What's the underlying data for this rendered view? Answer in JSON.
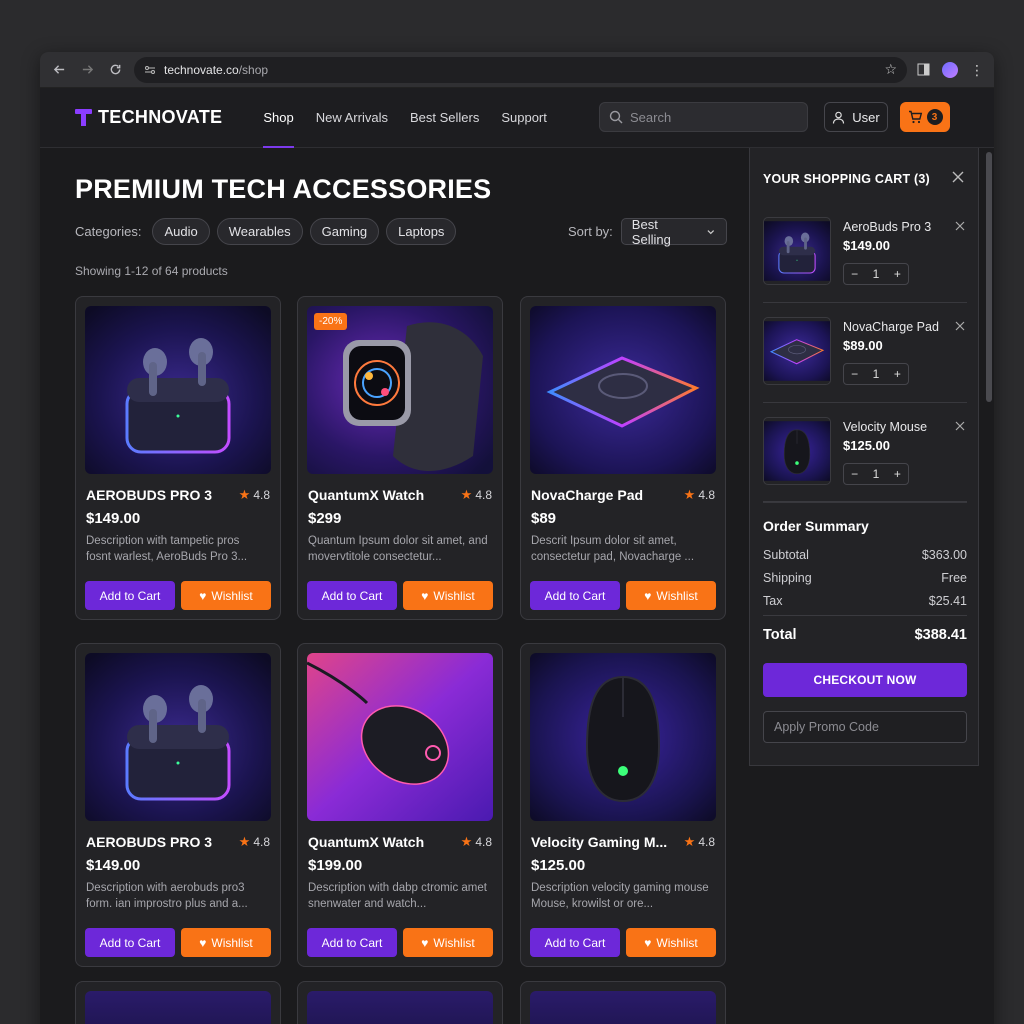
{
  "browser": {
    "url_domain": "technovate.co",
    "url_path": "/shop"
  },
  "header": {
    "logo_text": "TECHNOVATE",
    "nav": [
      {
        "label": "Shop",
        "active": true
      },
      {
        "label": "New Arrivals",
        "active": false
      },
      {
        "label": "Best Sellers",
        "active": false
      },
      {
        "label": "Support",
        "active": false
      }
    ],
    "search_placeholder": "Search",
    "user_label": "User",
    "cart_count": "3"
  },
  "main": {
    "title": "PREMIUM TECH ACCESSORIES",
    "categories_label": "Categories:",
    "categories": [
      "Audio",
      "Wearables",
      "Gaming",
      "Laptops"
    ],
    "sort_label": "Sort by:",
    "sort_value": "Best Selling",
    "showing_text": "Showing 1-12 of 64 products"
  },
  "products": [
    {
      "name": "AEROBUDS PRO 3",
      "rating": "4.8",
      "price": "$149.00",
      "description": "Description with tampetic pros fosnt warlest, AeroBuds Pro 3...",
      "image": "earbuds",
      "discount": ""
    },
    {
      "name": "QuantumX Watch",
      "rating": "4.8",
      "price": "$299",
      "description": "Quantum Ipsum dolor sit amet, and movervtitole consectetur...",
      "image": "watch",
      "discount": "-20%"
    },
    {
      "name": "NovaCharge Pad",
      "rating": "4.8",
      "price": "$89",
      "description": "Descrit Ipsum dolor sit amet, consectetur pad, Novacharge ...",
      "image": "pad",
      "discount": ""
    },
    {
      "name": "AEROBUDS PRO 3",
      "rating": "4.8",
      "price": "$149.00",
      "description": "Description with aerobuds pro3 form. ian improstro plus and a...",
      "image": "earbuds",
      "discount": ""
    },
    {
      "name": "QuantumX Watch",
      "rating": "4.8",
      "price": "$199.00",
      "description": "Description with dabp ctromic amet snenwater and watch...",
      "image": "mouse",
      "discount": ""
    },
    {
      "name": "Velocity Gaming M...",
      "rating": "4.8",
      "price": "$125.00",
      "description": "Description velocity gaming mouse Mouse, krowilst or ore...",
      "image": "gaming-mouse",
      "discount": ""
    }
  ],
  "button_labels": {
    "add_to_cart": "Add to Cart",
    "wishlist": "Wishlist"
  },
  "cart": {
    "title": "YOUR SHOPPING CART (3)",
    "items": [
      {
        "name": "AeroBuds Pro 3",
        "price": "$149.00",
        "qty": "1",
        "image": "earbuds"
      },
      {
        "name": "NovaCharge Pad",
        "price": "$89.00",
        "qty": "1",
        "image": "pad"
      },
      {
        "name": "Velocity Mouse",
        "price": "$125.00",
        "qty": "1",
        "image": "gaming-mouse"
      }
    ],
    "summary_title": "Order Summary",
    "subtotal_label": "Subtotal",
    "subtotal": "$363.00",
    "shipping_label": "Shipping",
    "shipping": "Free",
    "tax_label": "Tax",
    "tax": "$25.41",
    "total_label": "Total",
    "total": "$388.41",
    "checkout_label": "CHECKOUT NOW",
    "promo_placeholder": "Apply Promo Code"
  },
  "colors": {
    "accent_purple": "#6d28d9",
    "accent_orange": "#f97316",
    "background": "#1b1b1d"
  }
}
